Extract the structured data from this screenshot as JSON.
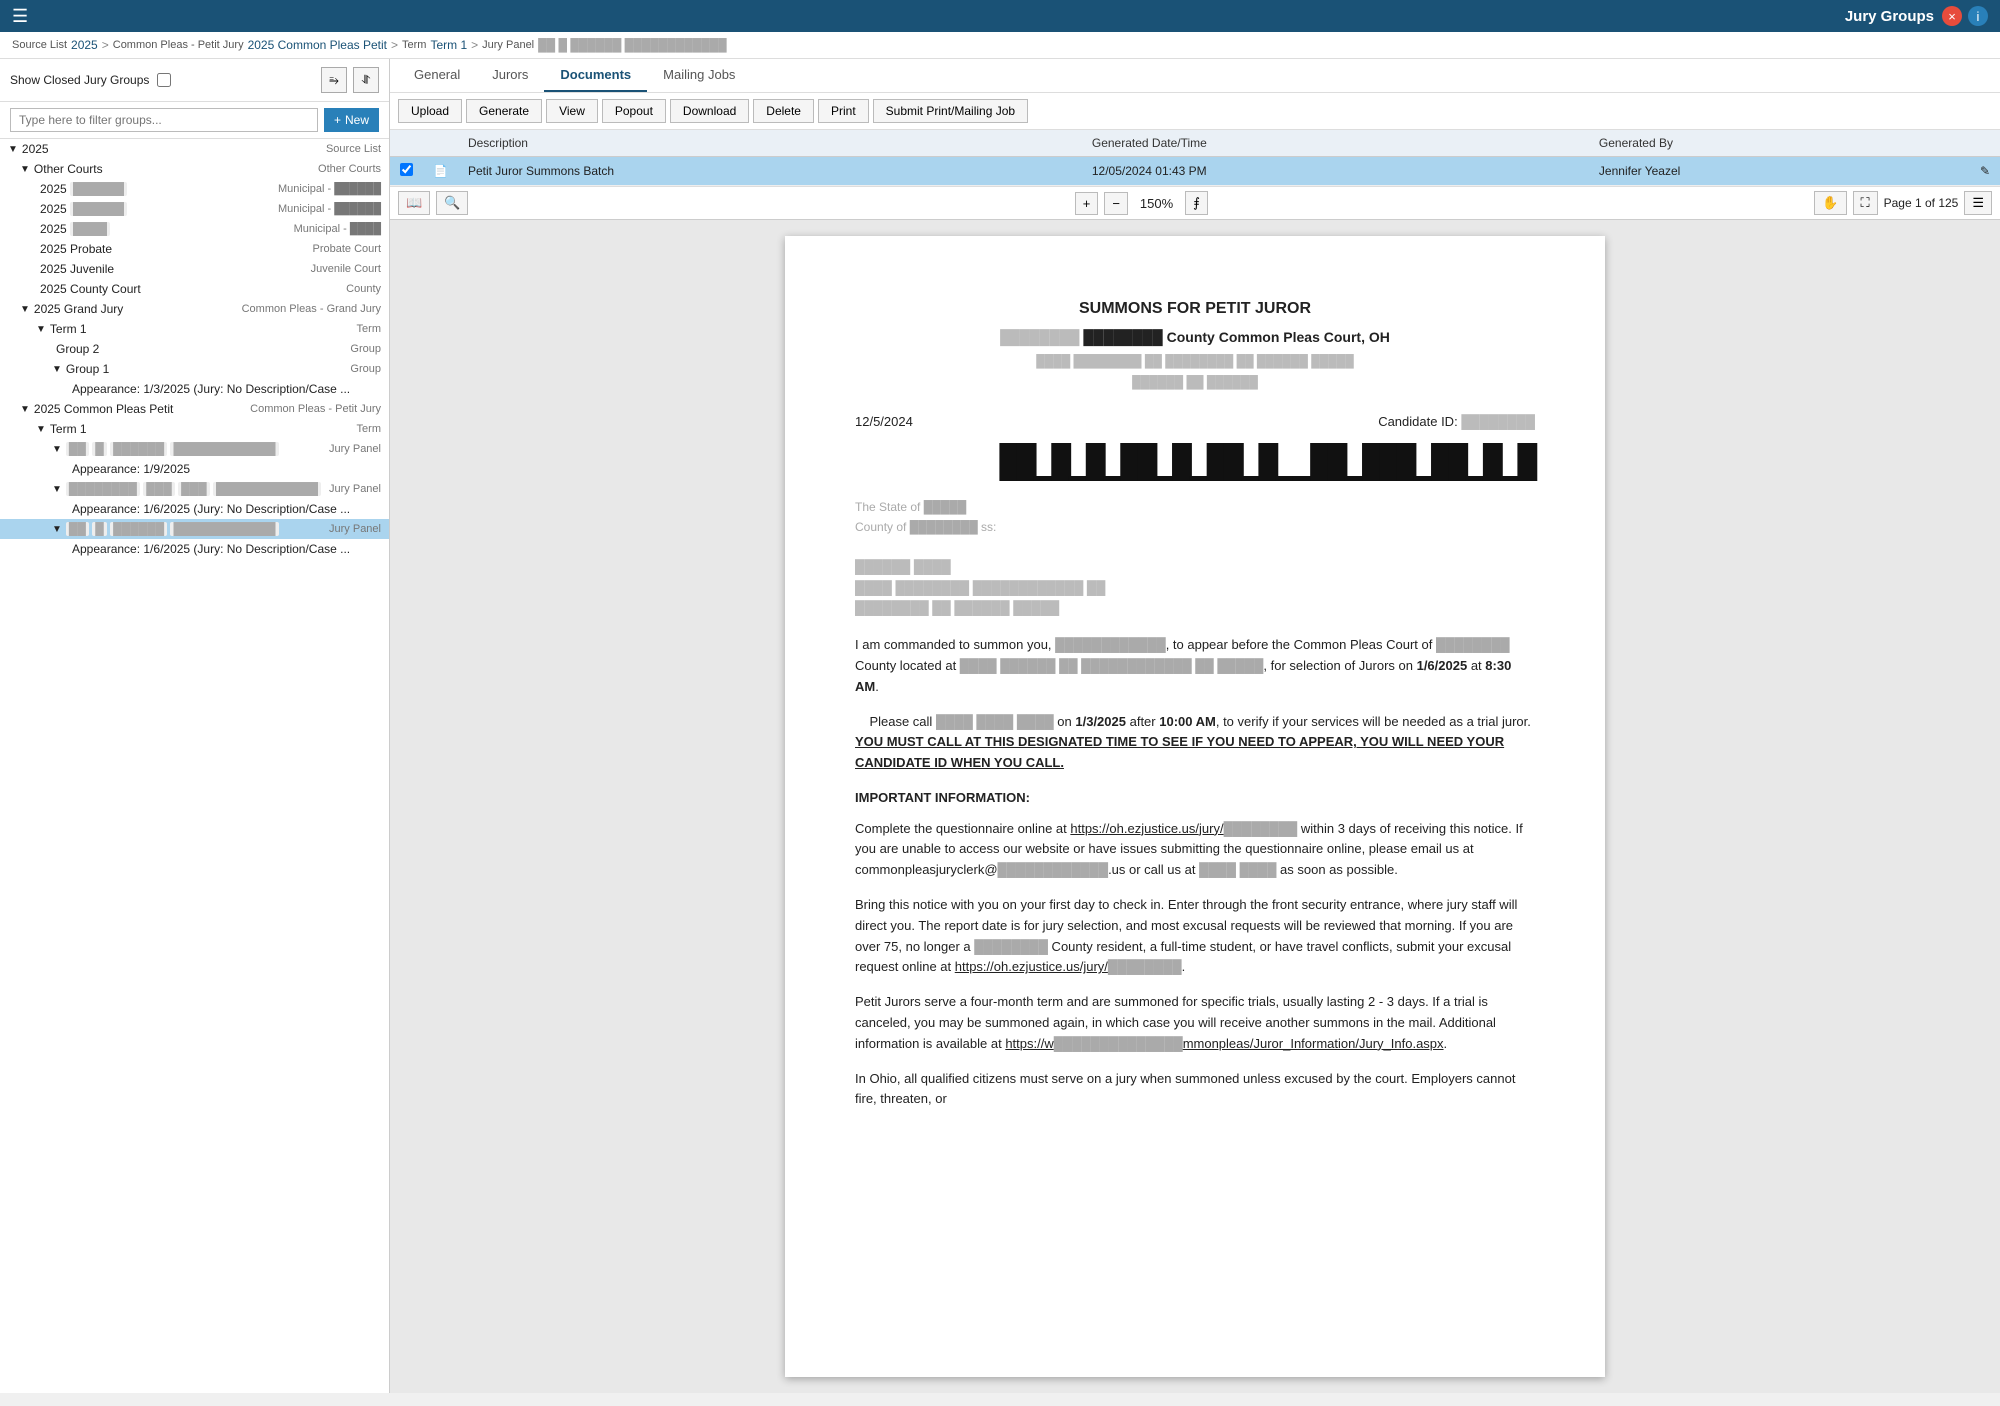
{
  "topbar": {
    "title": "Jury Groups",
    "close_label": "×",
    "info_label": "i"
  },
  "breadcrumb": {
    "source_list_label": "Source List",
    "source_list_value": "2025",
    "court_label": "Common Pleas - Petit Jury",
    "court_value": "2025 Common Pleas Petit",
    "term_label": "Term",
    "term_value": "Term 1",
    "panel_label": "Jury Panel",
    "panel_value": "██ █ ██████  ████████████"
  },
  "sidebar": {
    "show_closed_label": "Show Closed Jury Groups",
    "filter_placeholder": "Type here to filter groups...",
    "new_button": "New",
    "tree": [
      {
        "id": "2025",
        "label": "2025",
        "type": "Source List",
        "indent": 0,
        "expanded": true,
        "chevron": "▼"
      },
      {
        "id": "other-courts",
        "label": "Other Courts",
        "type": "Other Courts",
        "indent": 1,
        "expanded": true,
        "chevron": "▼"
      },
      {
        "id": "muni1",
        "label": "2025 ██████",
        "type": "Municipal - ██████",
        "indent": 2,
        "chevron": ""
      },
      {
        "id": "muni2",
        "label": "2025 ██████",
        "type": "Municipal - ██████",
        "indent": 2,
        "chevron": ""
      },
      {
        "id": "muni3",
        "label": "2025 ████",
        "type": "Municipal - ████",
        "indent": 2,
        "chevron": ""
      },
      {
        "id": "probate",
        "label": "2025 Probate",
        "type": "Probate Court",
        "indent": 2,
        "chevron": ""
      },
      {
        "id": "juvenile",
        "label": "2025 Juvenile",
        "type": "Juvenile Court",
        "indent": 2,
        "chevron": ""
      },
      {
        "id": "county",
        "label": "2025 County Court",
        "type": "County",
        "indent": 2,
        "chevron": ""
      },
      {
        "id": "grand-jury",
        "label": "2025 Grand Jury",
        "type": "Common Pleas - Grand Jury",
        "indent": 1,
        "expanded": true,
        "chevron": "▼"
      },
      {
        "id": "grand-term1",
        "label": "Term 1",
        "type": "Term",
        "indent": 2,
        "expanded": true,
        "chevron": "▼"
      },
      {
        "id": "grand-group2",
        "label": "Group 2",
        "type": "Group",
        "indent": 3,
        "chevron": ""
      },
      {
        "id": "grand-group1",
        "label": "Group 1",
        "type": "Group",
        "indent": 3,
        "expanded": true,
        "chevron": "▼"
      },
      {
        "id": "grand-appearance",
        "label": "Appearance: 1/3/2025 (Jury: No Description/Case ...",
        "type": "",
        "indent": 4,
        "chevron": ""
      },
      {
        "id": "cp-petit",
        "label": "2025 Common Pleas Petit",
        "type": "Common Pleas - Petit Jury",
        "indent": 1,
        "expanded": true,
        "chevron": "▼"
      },
      {
        "id": "cp-term1",
        "label": "Term 1",
        "type": "Term",
        "indent": 2,
        "expanded": true,
        "chevron": "▼"
      },
      {
        "id": "panel1",
        "label": "██ █ ██████  ████████████",
        "type": "Jury Panel",
        "indent": 3,
        "expanded": true,
        "chevron": "▼"
      },
      {
        "id": "appearance1",
        "label": "Appearance: 1/9/2025",
        "type": "",
        "indent": 4,
        "chevron": ""
      },
      {
        "id": "panel2",
        "label": "████████ ███ ███  ████████████",
        "type": "Jury Panel",
        "indent": 3,
        "expanded": true,
        "chevron": "▼"
      },
      {
        "id": "appearance2",
        "label": "Appearance: 1/6/2025 (Jury: No Description/Case ...",
        "type": "",
        "indent": 4,
        "chevron": ""
      },
      {
        "id": "panel3",
        "label": "██ █ ██████  ████████████",
        "type": "Jury Panel",
        "indent": 3,
        "expanded": true,
        "chevron": "▼",
        "selected": true
      },
      {
        "id": "appearance3",
        "label": "Appearance: 1/6/2025 (Jury: No Description/Case ...",
        "type": "",
        "indent": 4,
        "chevron": ""
      }
    ]
  },
  "right_panel": {
    "tabs": [
      "General",
      "Jurors",
      "Documents",
      "Mailing Jobs"
    ],
    "active_tab": "Documents",
    "actions": [
      "Upload",
      "Generate",
      "View",
      "Popout",
      "Download",
      "Delete",
      "Print",
      "Submit Print/Mailing Job"
    ],
    "table": {
      "headers": [
        "",
        "",
        "Description",
        "Generated Date/Time",
        "Generated By",
        ""
      ],
      "rows": [
        {
          "checked": true,
          "icon": "doc",
          "description": "Petit Juror Summons Batch",
          "generated_date": "12/05/2024 01:43 PM",
          "generated_by": "Jennifer Yeazel",
          "selected": true
        }
      ]
    },
    "pdf": {
      "zoom": "150%",
      "page_info": "Page 1 of 125",
      "title": "SUMMONS FOR PETIT JUROR",
      "subtitle": "████████ County Common Pleas Court, OH",
      "address1": "████ ████████ ██  ████████  ██  ██████  █████",
      "address2": "██████  ██  ██████",
      "date": "12/5/2024",
      "candidate_id_label": "Candidate ID:",
      "candidate_id_value": "████████",
      "state_line": "The State of █████",
      "county_line": "County of ████████ ss:",
      "recipient_name": "██████  ████",
      "recipient_addr1": "████  ████████  ████████████  ██",
      "recipient_addr2": "████████  ██  ██████  █████",
      "body1": "I am commanded to summon you, ████████████, to appear before the Common Pleas Court of ████████ County located at ████ ██████ ██ ████████████  ██  █████, for selection of Jurors on 1/6/2025 at 8:30 AM.",
      "body2_pre": "Please call ████  ████  ████ on ",
      "body2_date": "1/3/2025",
      "body2_mid": " after ",
      "body2_time": "10:00 AM",
      "body2_post": ", to verify if your services will be needed as a trial juror.",
      "body2_bold": "YOU MUST CALL AT THIS DESIGNATED TIME TO SEE IF YOU NEED TO APPEAR, YOU WILL NEED YOUR CANDIDATE ID WHEN YOU CALL.",
      "important_header": "IMPORTANT INFORMATION:",
      "body3": "Complete the questionnaire online at https://oh.ezjustice.us/jury/████████ within 3 days of receiving this notice. If you are unable to access our website or have issues submitting the questionnaire online, please email us at commonpleasjuryclerk@████████████.us or call us at ████  ████ as soon as possible.",
      "body4": "Bring this notice with you on your first day to check in. Enter through the front security entrance, where jury staff will direct you. The report date is for jury selection, and most excusal requests will be reviewed that morning. If you are over 75, no longer a ████████ County resident, a full-time student, or have travel conflicts, submit your excusal request online at https://oh.ezjustice.us/jury/████████.",
      "body5": "Petit Jurors serve a four-month term and are summoned for specific trials, usually lasting 2 - 3 days. If a trial is canceled, you may be summoned again, in which case you will receive another summons in the mail. Additional information is available at https://w██████████████mmonpleas/Juror_Information/Jury_Info.aspx.",
      "body6": "In Ohio, all qualified citizens must serve on a jury when summoned unless excused by the court. Employers cannot fire, threaten, or"
    }
  }
}
